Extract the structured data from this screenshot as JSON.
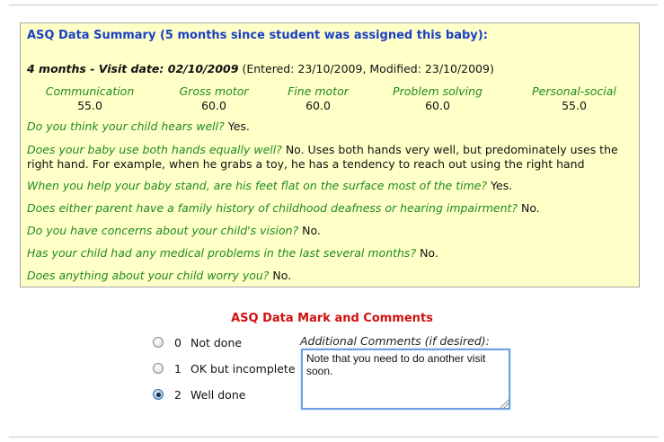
{
  "summary": {
    "title": "ASQ Data Summary (5 months since student was assigned this baby):",
    "visit_bold": "4 months - Visit date: 02/10/2009",
    "visit_rest": " (Entered: 23/10/2009, Modified: 23/10/2009)",
    "scores": [
      {
        "label": "Communication",
        "value": "55.0"
      },
      {
        "label": "Gross motor",
        "value": "60.0"
      },
      {
        "label": "Fine motor",
        "value": "60.0"
      },
      {
        "label": "Problem solving",
        "value": "60.0"
      },
      {
        "label": "Personal-social",
        "value": "55.0"
      }
    ],
    "qa": [
      {
        "q": "Do you think your child hears well?",
        "a": " Yes."
      },
      {
        "q": "Does your baby use both hands equally well?",
        "a": " No. Uses both hands very well, but predominately uses the right hand. For example, when he grabs a toy, he has a tendency to reach out using the right hand"
      },
      {
        "q": "When you help your baby stand, are his feet flat on the surface most of the time?",
        "a": " Yes."
      },
      {
        "q": "Does either parent have a family history of childhood deafness or hearing impairment?",
        "a": " No."
      },
      {
        "q": "Do you have concerns about your child's vision?",
        "a": " No."
      },
      {
        "q": "Has your child had any medical problems in the last several months?",
        "a": " No."
      },
      {
        "q": "Does anything about your child worry you?",
        "a": " No."
      }
    ]
  },
  "mark": {
    "title": "ASQ Data Mark and Comments",
    "options": [
      {
        "num": "0",
        "label": "Not done",
        "checked": false
      },
      {
        "num": "1",
        "label": "OK but incomplete",
        "checked": false
      },
      {
        "num": "2",
        "label": "Well done",
        "checked": true
      }
    ],
    "comments_label": "Additional Comments (if desired):",
    "comments_value": "Note that you need to do another visit soon."
  }
}
